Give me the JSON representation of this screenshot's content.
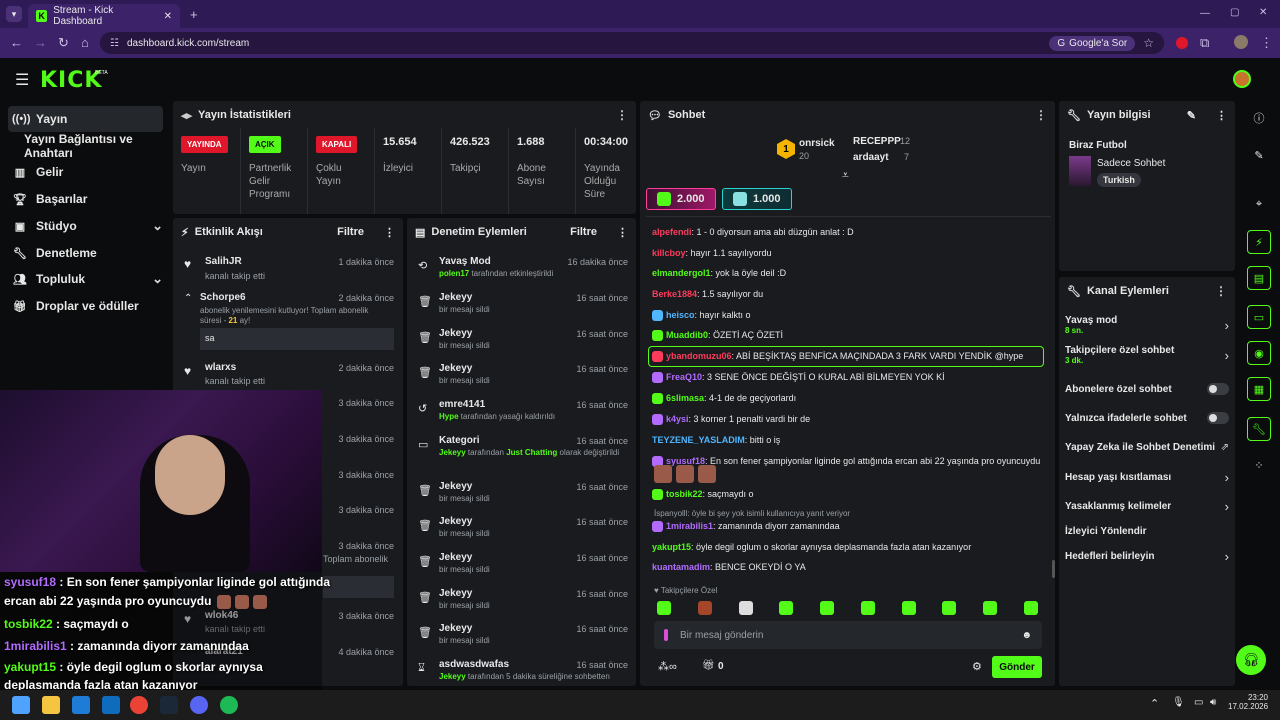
{
  "browser": {
    "tab_title": "Stream - Kick Dashboard",
    "url": "dashboard.kick.com/stream",
    "google_button": "Google'a Sor"
  },
  "brand": {
    "logo": "KICK",
    "beta": "BETA"
  },
  "nav": {
    "items": [
      {
        "label": "Yayın",
        "icon": "broadcast-icon"
      },
      {
        "label": "Yayın Bağlantısı ve Anahtarı"
      },
      {
        "label": "Gelir",
        "icon": "chart-icon"
      },
      {
        "label": "Başarılar",
        "icon": "trophy-icon"
      },
      {
        "label": "Stüdyo",
        "icon": "camera-icon"
      },
      {
        "label": "Denetleme",
        "icon": "wrench-icon"
      },
      {
        "label": "Topluluk",
        "icon": "people-icon"
      },
      {
        "label": "Droplar ve ödüller",
        "icon": "gift-icon"
      }
    ]
  },
  "stats": {
    "title": "Yayın İstatistikleri",
    "badges": [
      {
        "label": "YAYINDA",
        "sub": "Yayın",
        "color": "#e0162b"
      },
      {
        "label": "AÇIK",
        "sub": "Partnerlik Gelir Programı",
        "color": "#53fc18"
      },
      {
        "label": "KAPALI",
        "sub": "Çoklu Yayın",
        "color": "#e0162b"
      }
    ],
    "values": [
      {
        "v": "15.654",
        "l": "İzleyici"
      },
      {
        "v": "426.523",
        "l": "Takipçi"
      },
      {
        "v": "1.688",
        "l": "Abone Sayısı"
      },
      {
        "v": "00:34:00",
        "l": "Yayında Olduğu Süre"
      }
    ]
  },
  "activity": {
    "title": "Etkinlik Akışı",
    "filter": "Filtre",
    "items": [
      {
        "user": "SalihJR",
        "text": "kanalı takip etti",
        "time": "1 dakika önce"
      },
      {
        "user": "Schorpe6",
        "text": "abonelik yenilemesini kutluyor! Toplam abonelik süresi - ",
        "months": "21",
        "suffix": " ay!",
        "time": "2 dakika önce",
        "msg": "sa"
      },
      {
        "user": "wlarxs",
        "text": "kanalı takip etti",
        "time": "2 dakika önce"
      },
      {
        "time": "3 dakika önce"
      },
      {
        "time": "3 dakika önce"
      },
      {
        "time": "3 dakika önce"
      },
      {
        "time": "3 dakika önce"
      },
      {
        "time": "3 dakika önce",
        "text": "Toplam abonelik"
      },
      {
        "user": "wlok46",
        "text": "kanalı takip etti",
        "time": "3 dakika önce"
      },
      {
        "user": "alarat21",
        "time": "4 dakika önce"
      }
    ]
  },
  "moderation": {
    "title": "Denetim Eylemleri",
    "filter": "Filtre",
    "items": [
      {
        "title": "Yavaş Mod",
        "who": "polen17",
        "text": " tarafından etkinleştirildi",
        "time": "16 dakika önce"
      },
      {
        "title": "Jekeyy",
        "text": "bir mesajı sildi",
        "time": "16 saat önce"
      },
      {
        "title": "Jekeyy",
        "text": "bir mesajı sildi",
        "time": "16 saat önce"
      },
      {
        "title": "Jekeyy",
        "text": "bir mesajı sildi",
        "time": "16 saat önce"
      },
      {
        "title": "emre4141",
        "who": "Hype",
        "text": " tarafından yasağı kaldırıldı",
        "time": "16 saat önce"
      },
      {
        "title": "Kategori",
        "who": "Jekeyy",
        "text": " tarafından ",
        "cat": "Just Chatting",
        "text2": " olarak değiştirildi",
        "time": "16 saat önce"
      },
      {
        "title": "Jekeyy",
        "text": "bir mesajı sildi",
        "time": "16 saat önce"
      },
      {
        "title": "Jekeyy",
        "text": "bir mesajı sildi",
        "time": "16 saat önce"
      },
      {
        "title": "Jekeyy",
        "text": "bir mesajı sildi",
        "time": "16 saat önce"
      },
      {
        "title": "Jekeyy",
        "text": "bir mesajı sildi",
        "time": "16 saat önce"
      },
      {
        "title": "Jekeyy",
        "text": "bir mesajı sildi",
        "time": "16 saat önce"
      },
      {
        "title": "asdwasdwafas",
        "who": "Jekeyy",
        "text": " tarafından 5 dakika süreliğine sohbetten",
        "time": "16 saat önce"
      }
    ]
  },
  "chat": {
    "title": "Sohbet",
    "leader": {
      "rank": "1",
      "name": "onrsick",
      "count": "20"
    },
    "top": [
      {
        "name": "RECEPPP",
        "count": "12"
      },
      {
        "name": "ardaayt",
        "count": "7"
      }
    ],
    "gift1": "2.000",
    "gift2": "1.000",
    "lines": [
      {
        "u": "alpefendi",
        "c": "#ff3b5c",
        "t": ": 1 - 0 diyorsun ama abi düzgün anlat : D"
      },
      {
        "u": "killcboy",
        "c": "#ff3b5c",
        "t": ": hayır 1.1 sayılıyordu"
      },
      {
        "u": "elmandergol1",
        "c": "#53fc18",
        "t": ": yok la öyle deil :D"
      },
      {
        "u": "Berke1884",
        "c": "#ff3b5c",
        "t": ": 1.5 sayılıyor du"
      },
      {
        "u": "heisco",
        "c": "#4fb6ff",
        "t": ": hayır kalktı o"
      },
      {
        "u": "Muaddib0",
        "c": "#53fc18",
        "t": ": ÖZETİ AÇ ÖZETİ"
      },
      {
        "u": "ybandomuzu06",
        "c": "#ff3b5c",
        "t": ": ABİ BEŞİKTAŞ BENFİCA MAÇINDADA 3 FARK VARDI YENDİK @hype"
      },
      {
        "u": "FreaQ10",
        "c": "#b36bff",
        "t": ": 3 SENE ÖNCE DEĞİŞTİ O KURAL ABİ BİLMEYEN YOK Kİ"
      },
      {
        "u": "6slimasa",
        "c": "#53fc18",
        "t": ": 4-1 de de geçiyorlardı"
      },
      {
        "u": "k4ysi",
        "c": "#b36bff",
        "t": ": 3 korner 1 penalti vardi bir de"
      },
      {
        "u": "TEYZENE_YASLADIM",
        "c": "#4fb6ff",
        "t": ": bitti o iş"
      },
      {
        "u": "syusuf18",
        "c": "#b36bff",
        "t": ": En son fener şampiyonlar liginde gol attığında ercan abi 22 yaşında pro oyuncuydu"
      },
      {
        "u": "tosbik22",
        "c": "#53fc18",
        "t": ": saçmaydı o"
      },
      {
        "reply": "İspanyolll: öyle bi şey yok isimli kullanıcıya yanıt veriyor"
      },
      {
        "u": "1mirabilis1",
        "c": "#b36bff",
        "t": ": zamanında diyorr zamanındaa"
      },
      {
        "u": "yakupt15",
        "c": "#53fc18",
        "t": ": öyle degil oglum o skorlar aynıysa deplasmanda fazla atan kazanıyor"
      },
      {
        "u": "kuantamadim",
        "c": "#b36bff",
        "t": ": BENCE OKEYDİ O YA"
      }
    ],
    "followers_only": "Takipçilere Özel",
    "placeholder": "Bir mesaj gönderin",
    "send": "Gönder",
    "points": "0"
  },
  "overlay": {
    "lines": [
      {
        "u": "syusuf18",
        "c": "#b36bff",
        "t": " : En son fener şampiyonlar liginde gol attığında"
      },
      {
        "t": "ercan abi 22 yaşında pro oyuncuydu"
      },
      {
        "u": "tosbik22",
        "c": "#53fc18",
        "t": " : saçmaydı o"
      },
      {
        "u": "1mirabilis1",
        "c": "#b36bff",
        "t": " : zamanında diyorr zamanındaa"
      },
      {
        "u": "yakupt15",
        "c": "#53fc18",
        "t": " : öyle degil oglum o skorlar aynıysa"
      },
      {
        "t": "deplasmanda fazla atan kazanıyor"
      }
    ]
  },
  "info": {
    "title": "Yayın bilgisi",
    "stream_title": "Biraz Futbol",
    "category": "Sadece Sohbet",
    "tag": "Turkish"
  },
  "channel_actions": {
    "title": "Kanal Eylemleri",
    "items": [
      {
        "label": "Yavaş mod",
        "sub": "8 sn.",
        "type": "chev"
      },
      {
        "label": "Takipçilere özel sohbet",
        "sub": "3 dk.",
        "type": "chev"
      },
      {
        "label": "Abonelere özel sohbet",
        "type": "toggle"
      },
      {
        "label": "Yalnızca ifadelerle sohbet",
        "type": "toggle"
      },
      {
        "label": "Yapay Zeka ile Sohbet Denetimi",
        "type": "ext"
      },
      {
        "label": "Hesap yaşı kısıtlaması",
        "type": "chev"
      },
      {
        "label": "Yasaklanmış kelimeler",
        "type": "chev"
      },
      {
        "label": "İzleyici Yönlendir",
        "type": "none"
      },
      {
        "label": "Hedefleri belirleyin",
        "type": "chev"
      }
    ]
  },
  "taskbar": {
    "time": "23:20",
    "date": "17.02.2026"
  }
}
